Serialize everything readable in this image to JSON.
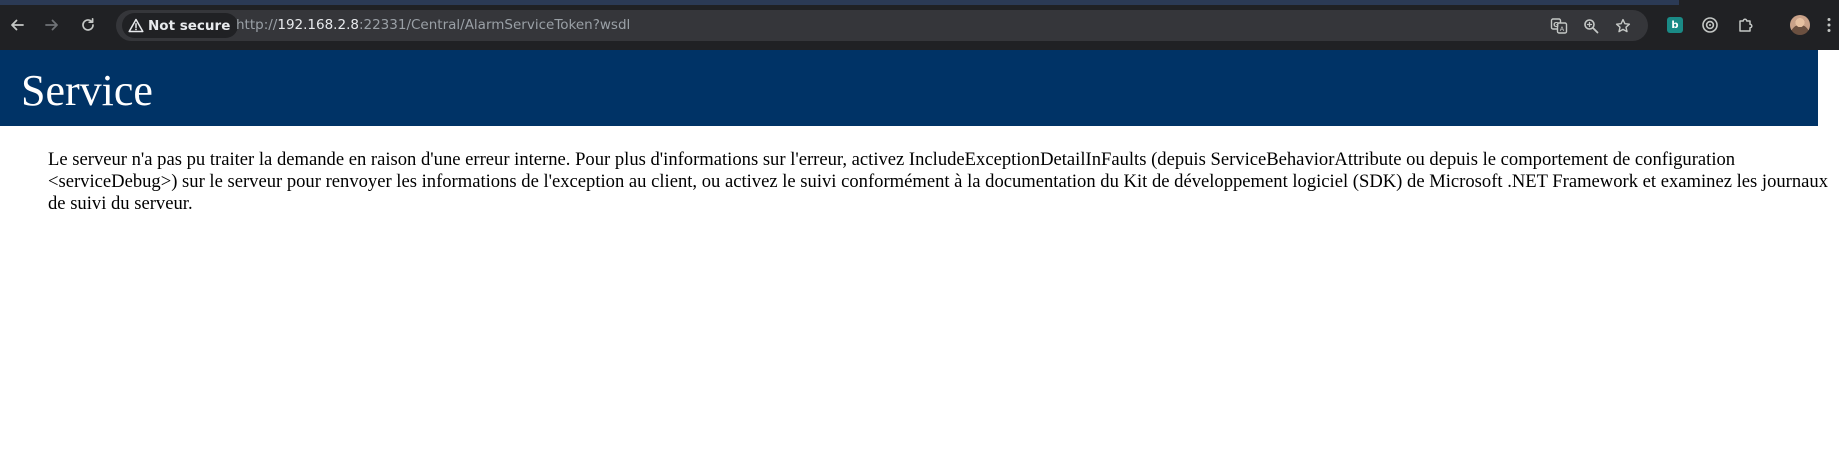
{
  "browser": {
    "security_label": "Not secure",
    "url": {
      "scheme": "http://",
      "host": "192.168.2.8",
      "rest": ":22331/Central/AlarmServiceToken?wsdl"
    },
    "icons": {
      "back": "back-arrow-icon",
      "forward": "forward-arrow-icon",
      "reload": "reload-icon",
      "warning": "warning-triangle-icon",
      "translate": "translate-icon",
      "zoom": "zoom-icon",
      "bookmark": "star-icon",
      "extension_b": "extension-b-icon",
      "extension_target": "target-icon",
      "extensions": "puzzle-icon",
      "profile": "avatar",
      "menu": "kebab-menu-icon"
    },
    "extension_b_letter": "b"
  },
  "page": {
    "title": "Service",
    "message": "Le serveur n'a pas pu traiter la demande en raison d'une erreur interne. Pour plus d'informations sur l'erreur, activez IncludeExceptionDetailInFaults (depuis ServiceBehaviorAttribute ou depuis le comportement de configuration <serviceDebug>) sur le serveur pour renvoyer les informations de l'exception au client, ou activez le suivi conformément à la documentation du Kit de développement logiciel (SDK) de Microsoft .NET Framework et examinez les journaux de suivi du serveur."
  },
  "colors": {
    "heading_background": "#003366",
    "heading_text": "#ffffff",
    "chrome_background": "#202124",
    "omnibox_background": "#35363a"
  }
}
